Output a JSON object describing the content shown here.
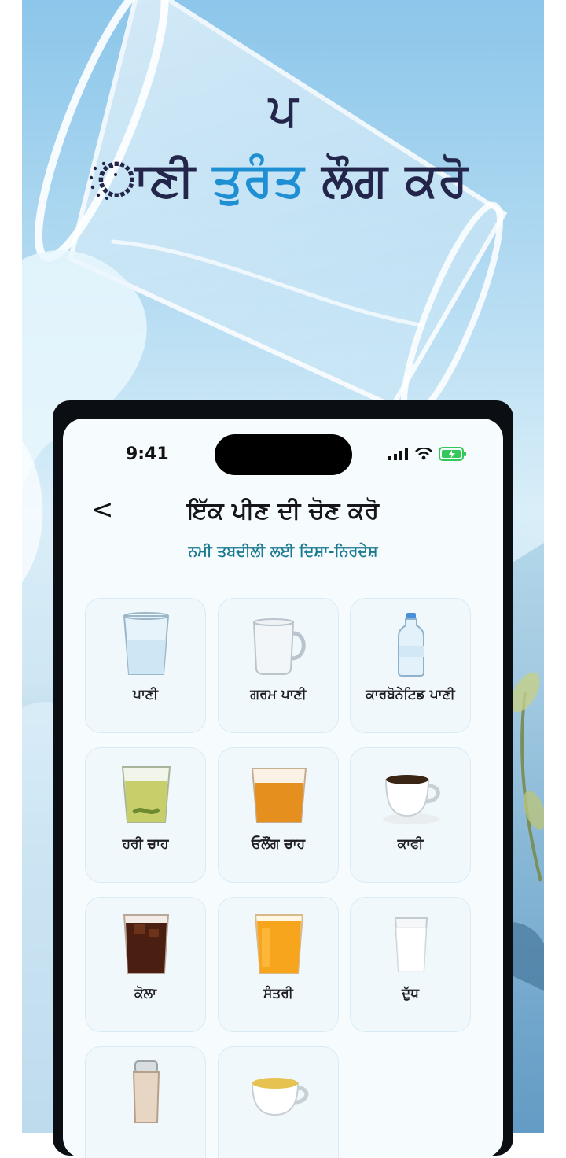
{
  "promo": {
    "headline_line1": "ਪ",
    "headline_line2_dark": "ਾਣੀ",
    "headline_line2_accent": "ਤੁਰੰਤ",
    "headline_line2_rest": "ਲੌਗ ਕਰੋ"
  },
  "status_bar": {
    "time": "9:41"
  },
  "header": {
    "back_label": "<",
    "title": "ਇੱਕ ਪੀਣ ਦੀ ਚੋਣ ਕਰੋ",
    "subtitle": "ਨਮੀ ਤਬਦੀਲੀ ਲਈ ਦਿਸ਼ਾ-ਨਿਰਦੇਸ਼"
  },
  "drinks": [
    {
      "label": "ਪਾਣੀ",
      "icon": "water-glass-icon"
    },
    {
      "label": "ਗਰਮ ਪਾਣੀ",
      "icon": "hot-water-mug-icon"
    },
    {
      "label": "ਕਾਰਬੋਨੇਟਿਡ ਪਾਣੀ",
      "icon": "water-bottle-icon"
    },
    {
      "label": "ਹਰੀ ਚਾਹ",
      "icon": "green-tea-icon"
    },
    {
      "label": "ਓਲੌਂਗ ਚਾਹ",
      "icon": "oolong-tea-icon"
    },
    {
      "label": "ਕਾਫੀ",
      "icon": "coffee-cup-icon"
    },
    {
      "label": "ਕੋਲਾ",
      "icon": "cola-glass-icon"
    },
    {
      "label": "ਸੰਤਰੀ",
      "icon": "orange-juice-icon"
    },
    {
      "label": "ਦੁੱਧ",
      "icon": "milk-glass-icon"
    },
    {
      "label": "",
      "icon": "protein-shake-icon"
    },
    {
      "label": "",
      "icon": "soup-cup-icon"
    }
  ],
  "colors": {
    "accent": "#1f8fd4",
    "headline": "#23264a",
    "subtitle": "#1b7a8f",
    "battery": "#34c759"
  }
}
